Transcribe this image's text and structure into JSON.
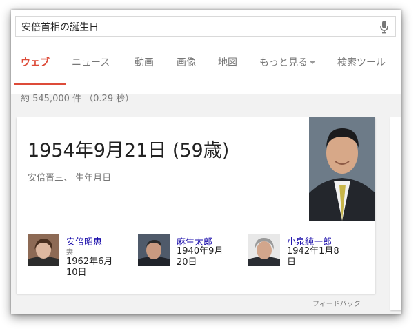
{
  "search": {
    "query": "安倍首相の誕生日",
    "mic_icon": "microphone-icon"
  },
  "tabs": [
    {
      "label": "ウェブ",
      "active": true
    },
    {
      "label": "ニュース"
    },
    {
      "label": "動画"
    },
    {
      "label": "画像"
    },
    {
      "label": "地図"
    },
    {
      "label": "もっと見る"
    },
    {
      "label": "検索ツール"
    }
  ],
  "result_stats": "約 545,000 件 （0.29 秒）",
  "answer": {
    "birth_date": "1954年9月21日 (59歳)",
    "subject": "安倍晋三、 生年月日"
  },
  "related": [
    {
      "name": "安倍昭恵",
      "relation": "妻",
      "date": "1962年6月10日"
    },
    {
      "name": "麻生太郎",
      "date": "1940年9月20日"
    },
    {
      "name": "小泉純一郎",
      "date": "1942年1月8日"
    }
  ],
  "feedback": "フィードバック",
  "colors": {
    "accent": "#dd4b39",
    "link": "#1a0dab",
    "muted": "#777777"
  }
}
